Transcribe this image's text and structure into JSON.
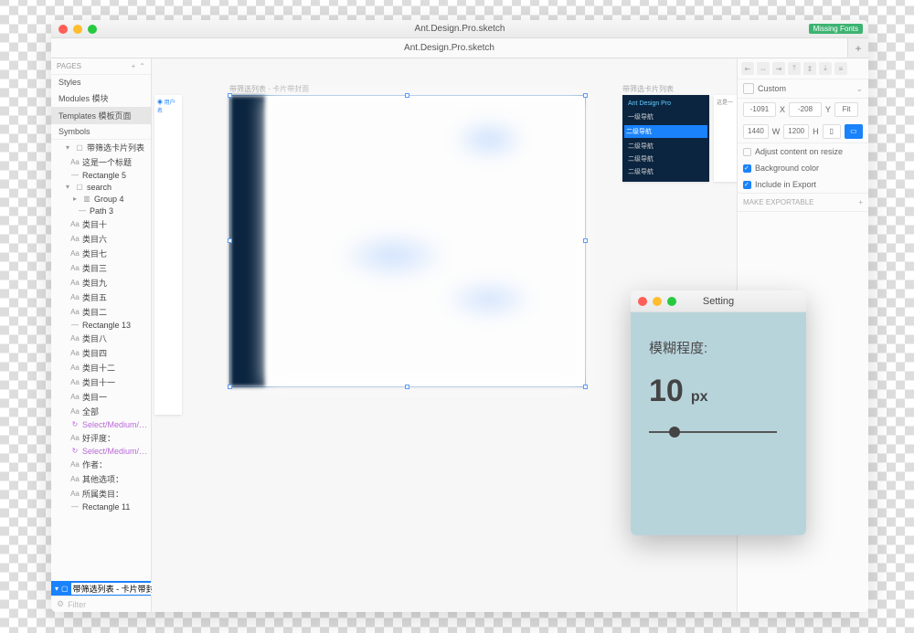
{
  "window": {
    "title": "Ant.Design.Pro.sketch",
    "badge": "Missing Fonts"
  },
  "tabs": [
    {
      "label": "Ant.Design.Pro.sketch"
    }
  ],
  "sidebar": {
    "pages_header": "PAGES",
    "pages": [
      "Styles",
      "Modules 模块",
      "Templates 模板页面",
      "Symbols"
    ],
    "selected_page": 2,
    "layers": [
      {
        "indent": 0,
        "icon": "▾",
        "glyph": "▢",
        "label": "带筛选卡片列表"
      },
      {
        "indent": 1,
        "icon": "Aa",
        "label": "这是一个标题"
      },
      {
        "indent": 1,
        "icon": "—",
        "label": "Rectangle 5"
      },
      {
        "indent": 0,
        "icon": "▾",
        "glyph": "▢",
        "label": "search"
      },
      {
        "indent": 1,
        "icon": "▸",
        "glyph": "▥",
        "label": "Group 4"
      },
      {
        "indent": 2,
        "icon": "—",
        "label": "Path 3"
      },
      {
        "indent": 1,
        "icon": "Aa",
        "label": "类目十"
      },
      {
        "indent": 1,
        "icon": "Aa",
        "label": "类目六"
      },
      {
        "indent": 1,
        "icon": "Aa",
        "label": "类目七"
      },
      {
        "indent": 1,
        "icon": "Aa",
        "label": "类目三"
      },
      {
        "indent": 1,
        "icon": "Aa",
        "label": "类目九"
      },
      {
        "indent": 1,
        "icon": "Aa",
        "label": "类目五"
      },
      {
        "indent": 1,
        "icon": "Aa",
        "label": "类目二"
      },
      {
        "indent": 1,
        "icon": "—",
        "label": "Rectangle 13"
      },
      {
        "indent": 1,
        "icon": "Aa",
        "label": "类目八"
      },
      {
        "indent": 1,
        "icon": "Aa",
        "label": "类目四"
      },
      {
        "indent": 1,
        "icon": "Aa",
        "label": "类目十二"
      },
      {
        "indent": 1,
        "icon": "Aa",
        "label": "类目十一"
      },
      {
        "indent": 1,
        "icon": "Aa",
        "label": "类目一"
      },
      {
        "indent": 1,
        "icon": "Aa",
        "label": "全部"
      },
      {
        "indent": 1,
        "icon": "↻",
        "label": "Select/Medium/…",
        "purple": true
      },
      {
        "indent": 1,
        "icon": "Aa",
        "label": "好评度："
      },
      {
        "indent": 1,
        "icon": "↻",
        "label": "Select/Medium/…",
        "purple": true
      },
      {
        "indent": 1,
        "icon": "Aa",
        "label": "作者："
      },
      {
        "indent": 1,
        "icon": "Aa",
        "label": "其他选项："
      },
      {
        "indent": 1,
        "icon": "Aa",
        "label": "所属类目："
      },
      {
        "indent": 1,
        "icon": "—",
        "label": "Rectangle 11"
      }
    ],
    "selected_artboard": "带筛选列表 - 卡片带封面",
    "filter_placeholder": "Filter"
  },
  "canvas": {
    "label_main": "带筛选列表 - 卡片带封面",
    "label_right": "带筛选卡片列表",
    "nav_header": "Ant Design Pro",
    "nav_items": [
      "一级导航",
      "二级导航",
      "二级导航",
      "二级导航",
      "二级导航"
    ],
    "side_text": "这是一"
  },
  "inspector": {
    "preset": "Custom",
    "x": "-1091",
    "y": "-208",
    "fit": "Fit",
    "w": "1440",
    "h": "1200",
    "adjust": "Adjust content on resize",
    "bg": "Background color",
    "export": "Include in Export",
    "exportable": "MAKE EXPORTABLE"
  },
  "setting": {
    "title": "Setting",
    "label": "模糊程度:",
    "value": "10",
    "unit": "px"
  }
}
